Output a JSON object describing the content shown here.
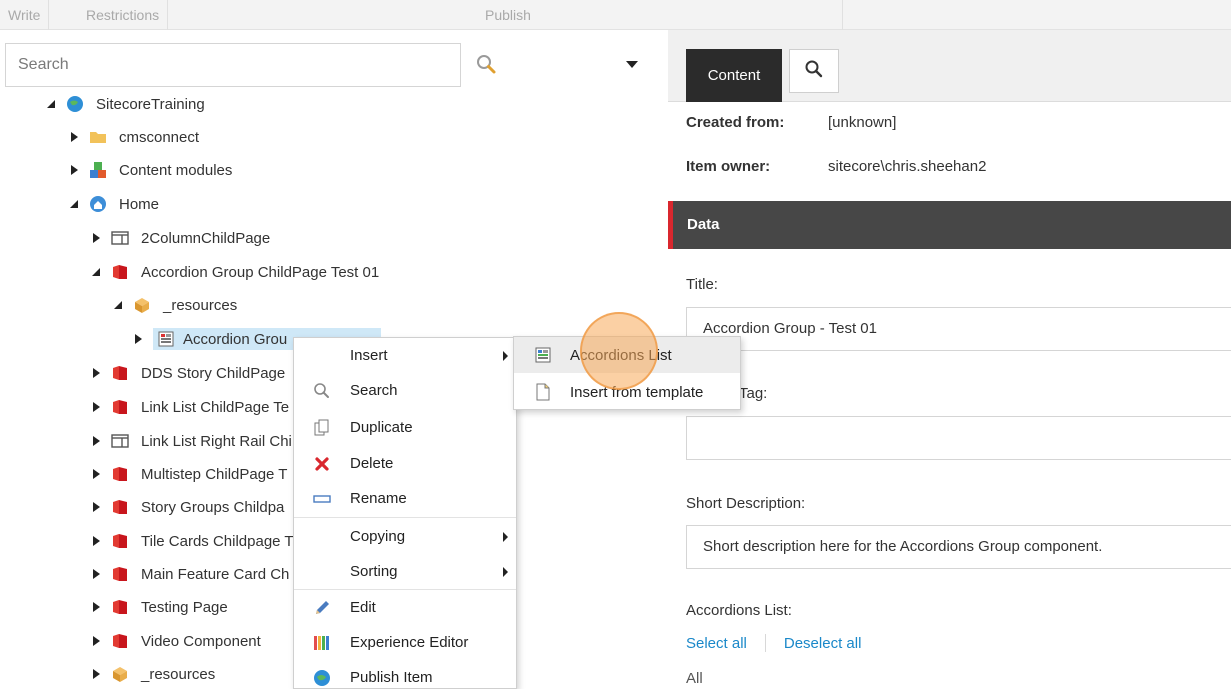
{
  "ribbon": {
    "tabs": [
      "Write",
      "Restrictions"
    ],
    "publish_label": "Publish"
  },
  "search": {
    "placeholder": "Search"
  },
  "tree": {
    "root": "SitecoreTraining",
    "nodes": [
      {
        "label": "cmsconnect",
        "icon": "folder-icon"
      },
      {
        "label": "Content modules",
        "icon": "modules-icon"
      },
      {
        "label": "Home",
        "icon": "home-globe-icon"
      },
      {
        "label": "2ColumnChildPage",
        "icon": "page-template-icon"
      },
      {
        "label": "Accordion Group ChildPage Test 01",
        "icon": "bookmark-red-icon"
      },
      {
        "label": "_resources",
        "icon": "resources-box-icon"
      },
      {
        "label": "Accordion Grou",
        "icon": "accordion-item-icon"
      },
      {
        "label": "DDS Story ChildPage",
        "icon": "bookmark-red-icon"
      },
      {
        "label": "Link List ChildPage Te",
        "icon": "bookmark-red-icon"
      },
      {
        "label": "Link List Right Rail Chi",
        "icon": "page-template-icon"
      },
      {
        "label": "Multistep ChildPage T",
        "icon": "bookmark-red-icon"
      },
      {
        "label": "Story Groups Childpa",
        "icon": "bookmark-red-icon"
      },
      {
        "label": "Tile Cards Childpage T",
        "icon": "bookmark-red-icon"
      },
      {
        "label": "Main Feature Card Ch",
        "icon": "bookmark-red-icon"
      },
      {
        "label": "Testing Page",
        "icon": "bookmark-red-icon"
      },
      {
        "label": "Video Component",
        "icon": "bookmark-red-icon"
      },
      {
        "label": "_resources",
        "icon": "resources-box-icon"
      }
    ]
  },
  "context_menu": {
    "items": [
      {
        "label": "Insert",
        "icon": "",
        "submenu": true
      },
      {
        "label": "Search",
        "icon": "search-icon",
        "submenu": false
      },
      {
        "label": "Duplicate",
        "icon": "duplicate-icon",
        "submenu": false
      },
      {
        "label": "Delete",
        "icon": "delete-x-icon",
        "submenu": false
      },
      {
        "label": "Rename",
        "icon": "rename-icon",
        "submenu": false
      },
      {
        "label": "Copying",
        "icon": "",
        "submenu": true
      },
      {
        "label": "Sorting",
        "icon": "",
        "submenu": true
      },
      {
        "label": "Edit",
        "icon": "pencil-icon",
        "submenu": false
      },
      {
        "label": "Experience Editor",
        "icon": "experience-editor-icon",
        "submenu": false
      },
      {
        "label": "Publish Item",
        "icon": "publish-globe-icon",
        "submenu": false
      }
    ]
  },
  "insert_submenu": {
    "items": [
      {
        "label": "Accordions List",
        "icon": "accordion-item-icon",
        "highlighted": true
      },
      {
        "label": "Insert from template",
        "icon": "template-page-icon",
        "highlighted": false
      }
    ]
  },
  "panel": {
    "tabs": {
      "content": "Content"
    },
    "created_from_label": "Created from:",
    "created_from_value": "[unknown]",
    "item_owner_label": "Item owner:",
    "item_owner_value": "sitecore\\chris.sheehan2",
    "section_title": "Data",
    "title_label": "Title:",
    "title_value": "Accordion Group - Test 01",
    "tag_label": "Tag:",
    "tag_value": "",
    "short_desc_label": "Short Description:",
    "short_desc_value": "Short description here for the Accordions Group component.",
    "accordions_list_label": "Accordions List:",
    "select_all": "Select all",
    "deselect_all": "Deselect all",
    "all_label": "All"
  },
  "colors": {
    "accent_red": "#d9272e",
    "link_blue": "#1a88c9",
    "section_dark": "#474747",
    "selected_row": "#cfe8f7",
    "click_highlight": "#f7aa5a"
  }
}
